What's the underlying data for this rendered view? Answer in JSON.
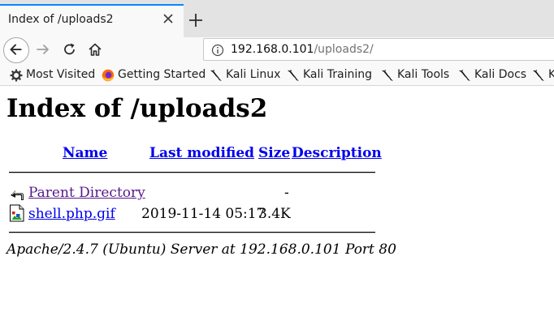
{
  "browser": {
    "tab": {
      "title": "Index of /uploads2"
    },
    "url": {
      "host": "192.168.0.101",
      "path": "/uploads2/"
    },
    "bookmarks": [
      {
        "label": "Most Visited",
        "icon": "gear-icon"
      },
      {
        "label": "Getting Started",
        "icon": "firefox-icon"
      },
      {
        "label": "Kali Linux",
        "icon": "kali-dragon-icon"
      },
      {
        "label": "Kali Training",
        "icon": "kali-dragon-icon"
      },
      {
        "label": "Kali Tools",
        "icon": "kali-dragon-icon"
      },
      {
        "label": "Kali Docs",
        "icon": "kali-dragon-icon"
      },
      {
        "label": "K",
        "icon": "kali-dragon-icon"
      }
    ]
  },
  "page": {
    "heading": "Index of /uploads2",
    "columns": {
      "name": "Name",
      "modified": "Last modified",
      "size": "Size",
      "description": "Description"
    },
    "rows": [
      {
        "name": "Parent Directory",
        "modified": "",
        "size": "-",
        "description": "",
        "icon": "back-folder-icon"
      },
      {
        "name": "shell.php.gif",
        "modified": "2019-11-14 05:17",
        "size": "3.4K",
        "description": "",
        "icon": "image-file-icon"
      }
    ],
    "address": "Apache/2.4.7 (Ubuntu) Server at 192.168.0.101 Port 80"
  },
  "colors": {
    "link": "#0000ee",
    "visited": "#551a8b",
    "accent": "#0a84ff"
  }
}
